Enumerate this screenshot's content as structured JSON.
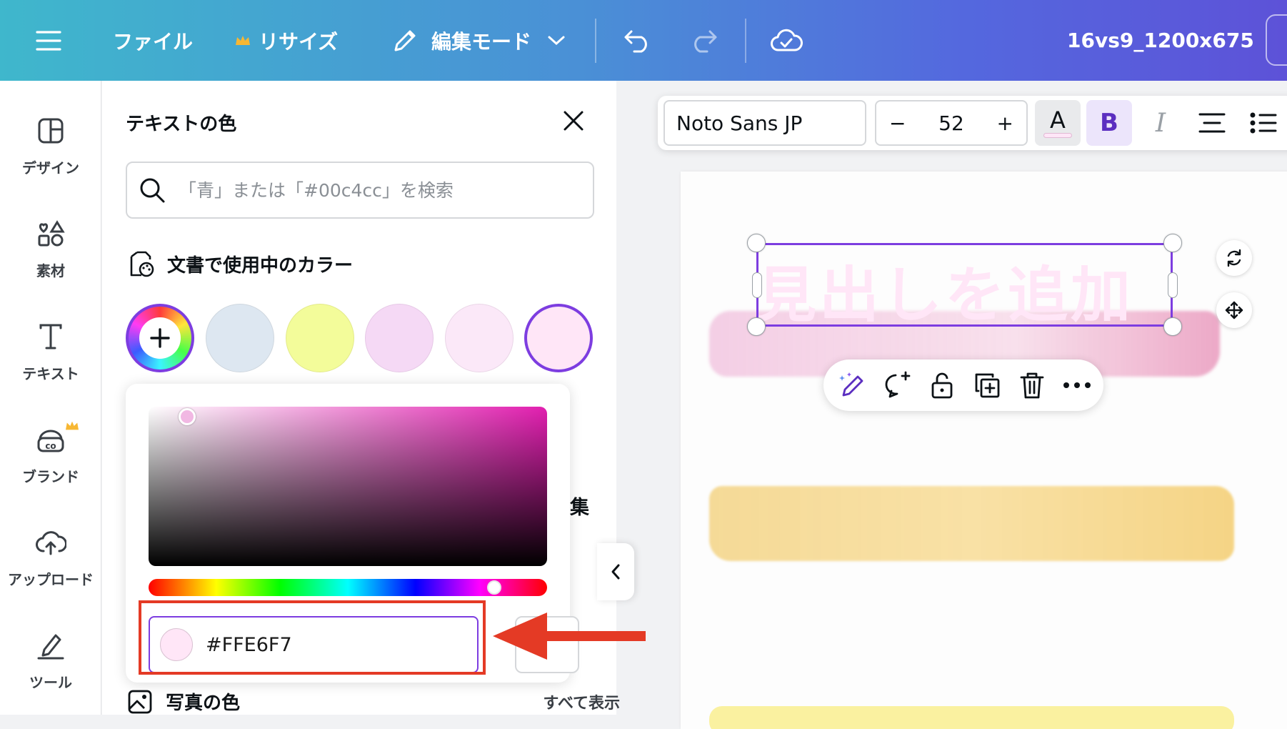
{
  "header": {
    "file_label": "ファイル",
    "resize_label": "リサイズ",
    "edit_mode_label": "編集モード",
    "doc_title": "16vs9_1200x675"
  },
  "sidebar": {
    "items": [
      {
        "label": "デザイン",
        "icon": "layout-icon"
      },
      {
        "label": "素材",
        "icon": "elements-icon"
      },
      {
        "label": "テキスト",
        "icon": "text-icon"
      },
      {
        "label": "ブランド",
        "icon": "brand-icon"
      },
      {
        "label": "アップロード",
        "icon": "upload-cloud-icon"
      },
      {
        "label": "ツール",
        "icon": "tools-icon"
      }
    ]
  },
  "panel": {
    "title": "テキストの色",
    "search_placeholder": "「青」または「#00c4cc」を検索",
    "doc_colors_label": "文書で使用中のカラー",
    "swatches": [
      "#dde7f1",
      "#f3fc9a",
      "#f5d9f5",
      "#fbe8f8",
      "#FFE6F7"
    ],
    "hex_value": "#FFE6F7",
    "partial_label": "集",
    "photo_colors_label": "写真の色",
    "show_all_label": "すべて表示"
  },
  "toolbar": {
    "font_name": "Noto Sans JP",
    "font_size": "52",
    "minus": "−",
    "plus": "+",
    "color_letter": "A",
    "bold_letter": "B",
    "italic_letter": "I"
  },
  "canvas": {
    "heading": "見出しを追加"
  },
  "colors": {
    "accent": "#7d3de0",
    "annotation": "#e43a25"
  }
}
